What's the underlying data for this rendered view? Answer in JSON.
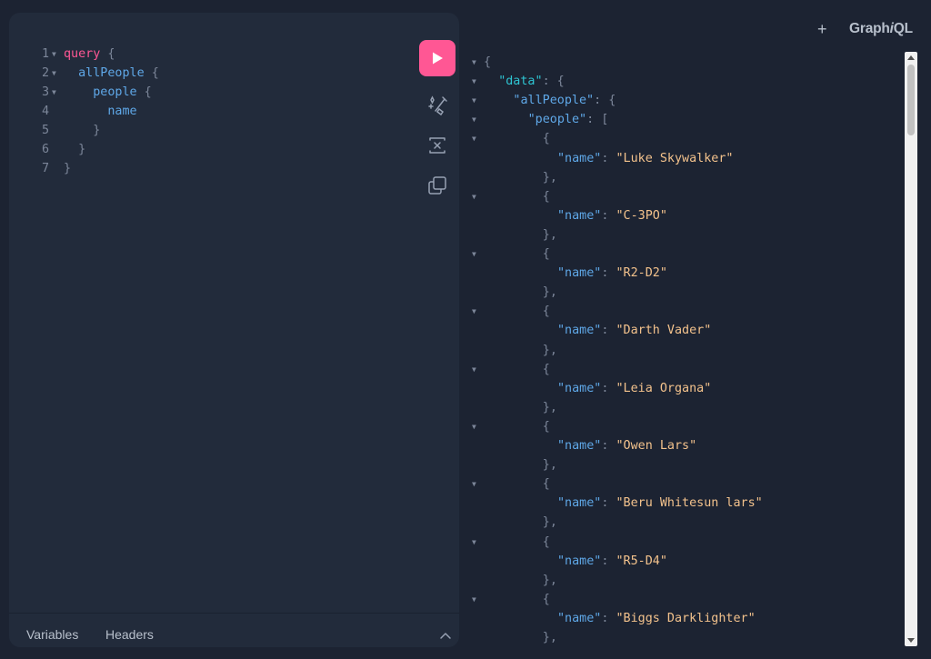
{
  "editor": {
    "lines": [
      {
        "num": "1",
        "fold": true,
        "parts": [
          {
            "t": "query",
            "c": "kw"
          },
          {
            "t": " {",
            "c": "pun"
          }
        ]
      },
      {
        "num": "2",
        "fold": true,
        "parts": [
          {
            "t": "  allPeople",
            "c": "fld"
          },
          {
            "t": " {",
            "c": "pun"
          }
        ]
      },
      {
        "num": "3",
        "fold": true,
        "parts": [
          {
            "t": "    people",
            "c": "fld"
          },
          {
            "t": " {",
            "c": "pun"
          }
        ]
      },
      {
        "num": "4",
        "fold": false,
        "parts": [
          {
            "t": "      name",
            "c": "fld"
          }
        ]
      },
      {
        "num": "5",
        "fold": false,
        "parts": [
          {
            "t": "    }",
            "c": "pun"
          }
        ]
      },
      {
        "num": "6",
        "fold": false,
        "parts": [
          {
            "t": "  }",
            "c": "pun"
          }
        ]
      },
      {
        "num": "7",
        "fold": false,
        "parts": [
          {
            "t": "}",
            "c": "pun"
          }
        ]
      }
    ],
    "bottom_tabs": [
      "Variables",
      "Headers"
    ]
  },
  "header": {
    "plus": "+",
    "logo_prefix": "Graph",
    "logo_italic": "i",
    "logo_suffix": "QL"
  },
  "result": {
    "people": [
      "Luke Skywalker",
      "C-3PO",
      "R2-D2",
      "Darth Vader",
      "Leia Organa",
      "Owen Lars",
      "Beru Whitesun lars",
      "R5-D4",
      "Biggs Darklighter"
    ]
  },
  "colors": {
    "accent": "#ff5794",
    "keyword": "#ff5794",
    "field": "#5fa8e8",
    "string": "#f3c28c",
    "root_key": "#2ec5d3"
  }
}
